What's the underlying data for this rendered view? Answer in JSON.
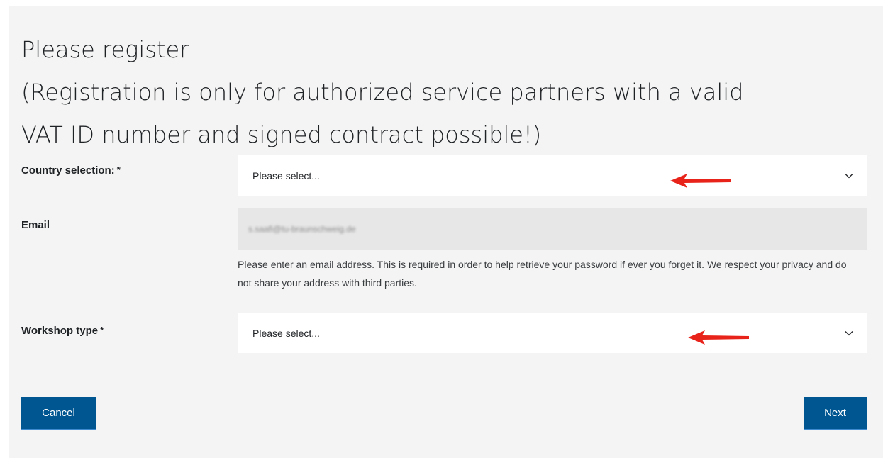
{
  "page": {
    "title_line1": "Please register",
    "title_line2": "(Registration is only for authorized service partners with a valid",
    "title_line3": "VAT ID number and signed contract possible!)"
  },
  "form": {
    "country": {
      "label": "Country selection:",
      "required_mark": "*",
      "selected": "Please select..."
    },
    "email": {
      "label": "Email",
      "value": "s.saafi@tu-braunschweig.de",
      "help": "Please enter an email address. This is required in order to help retrieve your password if ever you forget it. We respect your privacy and do not share your address with third parties."
    },
    "workshop": {
      "label": "Workshop type",
      "required_mark": "*",
      "selected": "Please select..."
    }
  },
  "actions": {
    "cancel_label": "Cancel",
    "next_label": "Next"
  },
  "colors": {
    "panel_bg": "#f4f4f4",
    "button_bg": "#005691",
    "annotation_arrow": "#e8231a"
  },
  "icons": {
    "dropdown": "chevron-down-icon",
    "annotation": "red-arrow-annotation"
  }
}
